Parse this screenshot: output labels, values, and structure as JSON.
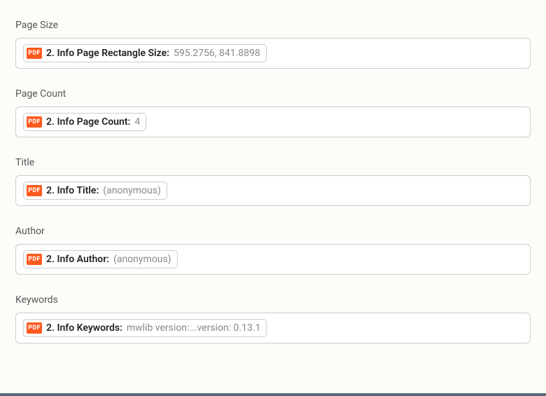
{
  "badge_text": "PDF",
  "fields": [
    {
      "heading": "Page Size",
      "label": "2. Info Page Rectangle Size:",
      "value": "595.2756, 841.8898"
    },
    {
      "heading": "Page Count",
      "label": "2. Info Page Count:",
      "value": "4"
    },
    {
      "heading": "Title",
      "label": "2. Info Title:",
      "value": "(anonymous)"
    },
    {
      "heading": "Author",
      "label": "2. Info Author:",
      "value": "(anonymous)"
    },
    {
      "heading": "Keywords",
      "label": "2. Info Keywords:",
      "value": "mwlib version:...version: 0.13.1"
    }
  ]
}
